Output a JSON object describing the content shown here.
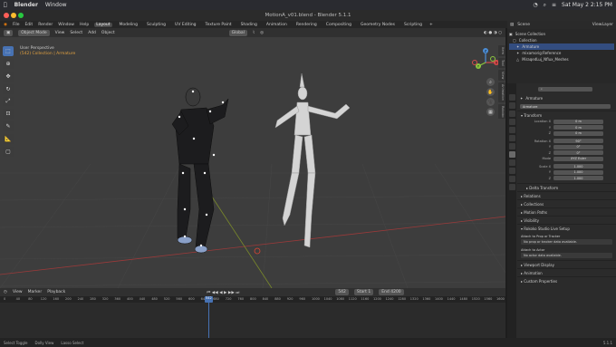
{
  "macos": {
    "app": "Blender",
    "menu": [
      "Window"
    ],
    "datetime": "Sat May 2  2:15 PM"
  },
  "window": {
    "title": "MotionA_v01.blend - Blender 5.1.1"
  },
  "menus": [
    "File",
    "Edit",
    "Render",
    "Window",
    "Help"
  ],
  "workspaces": [
    "Layout",
    "Modeling",
    "Sculpting",
    "UV Editing",
    "Texture Paint",
    "Shading",
    "Animation",
    "Rendering",
    "Compositing",
    "Geometry Nodes",
    "Scripting"
  ],
  "active_workspace": "Layout",
  "viewport": {
    "mode": "Object Mode",
    "menus": [
      "View",
      "Select",
      "Add",
      "Object"
    ],
    "transform": "Global",
    "options": "Options",
    "overlay_line1": "User Perspective",
    "overlay_line2": "(542) Collection | Armature",
    "gizmo_axes": {
      "x": "X",
      "y": "Y",
      "z": "Z"
    },
    "npanel_tabs": [
      "Item",
      "Tool",
      "View",
      "Animation",
      "Rokoko"
    ]
  },
  "timeline": {
    "menus": [
      "View",
      "Marker",
      "Playback"
    ],
    "current_frame": "542",
    "start_label": "Start",
    "start": "1",
    "end_label": "End",
    "end": "4200",
    "ruler": [
      "0",
      "40",
      "80",
      "120",
      "160",
      "200",
      "240",
      "280",
      "320",
      "360",
      "400",
      "440",
      "480",
      "520",
      "560",
      "600",
      "640",
      "680",
      "720",
      "760",
      "800",
      "840",
      "880",
      "920",
      "960",
      "1000",
      "1040",
      "1080",
      "1120",
      "1160",
      "1200",
      "1240",
      "1280",
      "1320",
      "1360",
      "1400",
      "1440",
      "1480",
      "1520",
      "1560",
      "1600"
    ],
    "playhead_label": "542"
  },
  "statusbar": {
    "items": [
      "Select Toggle",
      "Dolly View",
      "Lasso Select"
    ],
    "version": "5.1.1"
  },
  "outliner": {
    "scene": "Scene",
    "viewlayer": "ViewLayer",
    "rows": [
      "Scene Collection",
      "Collection",
      "Armature",
      "mixamorig:Reference",
      "MiraqedLuj_Nflux_Meshes"
    ]
  },
  "properties": {
    "search_placeholder": "",
    "object_name": "Armature",
    "datablock": "Armature",
    "sections": {
      "transform": "Transform",
      "delta": "Delta Transform",
      "relations": "Relations",
      "collections": "Collections",
      "motion_paths": "Motion Paths",
      "visibility": "Visibility",
      "rokoko": "Rokoko Studio Live Setup",
      "viewport_display": "Viewport Display",
      "animation": "Animation",
      "custom_props": "Custom Properties"
    },
    "location": {
      "label": "Location X",
      "y": "Y",
      "z": "Z",
      "x_val": "0 m",
      "y_val": "0 m",
      "z_val": "0 m"
    },
    "rotation": {
      "label": "Rotation X",
      "y": "Y",
      "z": "Z",
      "x_val": "90°",
      "y_val": "0°",
      "z_val": "0°"
    },
    "mode": {
      "label": "Mode",
      "value": "XYZ Euler"
    },
    "scale": {
      "label": "Scale X",
      "y": "Y",
      "z": "Z",
      "x_val": "1.000",
      "y_val": "1.000",
      "z_val": "1.000"
    },
    "attach_prop": "Attach to Prop or Tracker",
    "attach_prop_msg": "No prop or tracker data available.",
    "attach_actor": "Attach to Actor",
    "attach_actor_msg": "No actor data available."
  },
  "colors": {
    "accent": "#4772b3",
    "x_axis": "#d64b4b",
    "y_axis": "#8cc63f",
    "z_axis": "#4c8ed6",
    "playhead": "#4772b3"
  }
}
